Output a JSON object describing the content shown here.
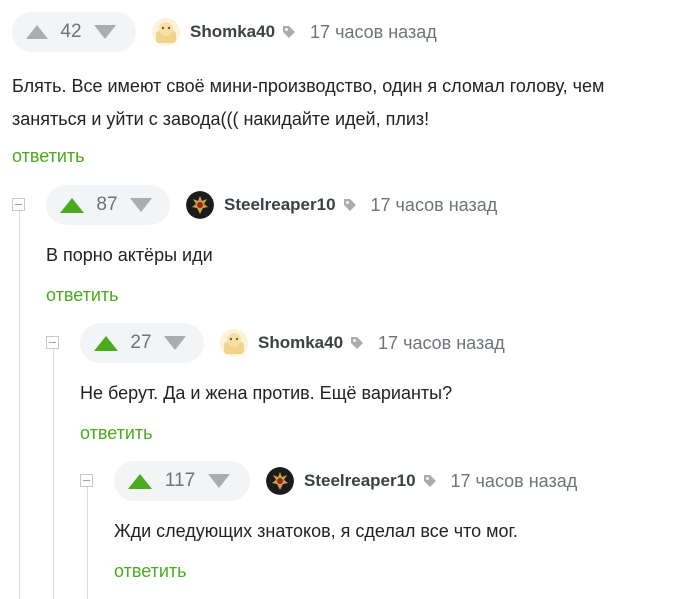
{
  "comments": [
    {
      "rating": "42",
      "author": "Shomka40",
      "time": "17 часов назад",
      "text_lines": [
        "Блять. Все имеют своё мини-производство, один я сломал голову, чем",
        "заняться и уйти с завода((( накидайте идей, плиз!"
      ],
      "reply_label": "ответить",
      "upvoted": false
    },
    {
      "rating": "87",
      "author": "Steelreaper10",
      "time": "17 часов назад",
      "text_lines": [
        "В порно актёры иди"
      ],
      "reply_label": "ответить",
      "upvoted": true
    },
    {
      "rating": "27",
      "author": "Shomka40",
      "time": "17 часов назад",
      "text_lines": [
        "Не берут. Да и жена против. Ещё варианты?"
      ],
      "reply_label": "ответить",
      "upvoted": true
    },
    {
      "rating": "117",
      "author": "Steelreaper10",
      "time": "17 часов назад",
      "text_lines": [
        "Жди следующих знатоков, я сделал все что мог."
      ],
      "reply_label": "ответить",
      "upvoted": true
    }
  ],
  "colors": {
    "accent": "#4caa1f",
    "muted": "#a9adb2",
    "voter_bg": "#f3f4f5"
  },
  "icons": {
    "tag": "tag-icon",
    "collapse": "collapse-icon",
    "upvote": "upvote-arrow-icon",
    "downvote": "downvote-arrow-icon"
  }
}
